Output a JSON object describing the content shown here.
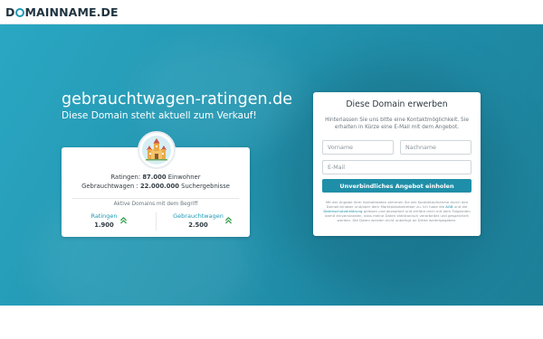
{
  "brand": {
    "logo_prefix": "D",
    "logo_rest": "MAINNAME.DE",
    "accent": "#1f9bb5"
  },
  "hero": {
    "domain": "gebrauchtwagen-ratingen.de",
    "subtitle": "Diese Domain steht aktuell zum Verkauf!"
  },
  "info": {
    "icon": "town-hall-icon",
    "line1_label": "Ratingen:",
    "line1_value": "87.000",
    "line1_unit": "Einwohner",
    "line2_label": "Gebrauchtwagen :",
    "line2_value": "22.000.000",
    "line2_unit": "Suchergebnisse",
    "active_label": "Aktive Domains mit dem Begriff",
    "keywords": [
      {
        "name": "Ratingen",
        "count": "1.900"
      },
      {
        "name": "Gebrauchtwagen",
        "count": "2.500"
      }
    ]
  },
  "form": {
    "title": "Diese Domain erwerben",
    "desc": "Hinterlassen Sie uns bitte eine Kontaktmöglichkeit. Sie erhalten in Kürze eine E-Mail mit dem Angebot.",
    "first_name_placeholder": "Vorname",
    "last_name_placeholder": "Nachname",
    "email_placeholder": "E-Mail",
    "submit_label": "Unverbindliches Angebot einholen",
    "legal_part1": "Mit der Angabe Ihrer Kontaktdaten stimmen Sie der Kontaktaufnahme durch den Domaininhaber und/oder dem Marktplatzbetreiber zu. Ich habe die",
    "legal_agb": "AGB",
    "legal_part2": "und die",
    "legal_privacy": "Datenschutzerklärung",
    "legal_part3": "gelesen und akzeptiert und erkläre mich mit dem Folgenden damit einverstanden, dass meine Daten elektronisch verarbeitet und gespeichert werden. Die Daten werden nicht unbefugt an Dritte weitergegeben."
  }
}
